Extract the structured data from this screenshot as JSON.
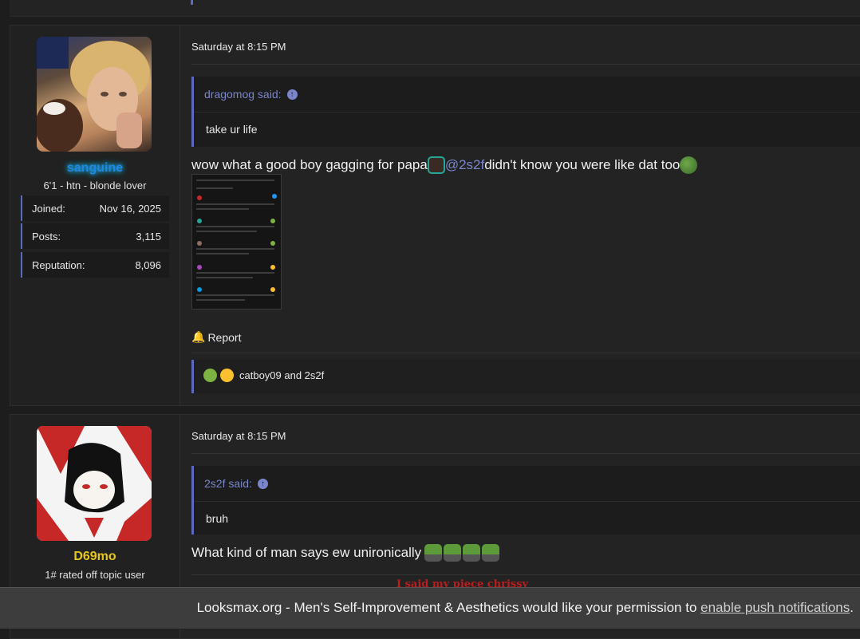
{
  "posts": [
    {
      "username": "sanguine",
      "user_title": "6'1 - htn - blonde lover",
      "stats": [
        {
          "label": "Joined:",
          "value": "Nov 16, 2025"
        },
        {
          "label": "Posts:",
          "value": "3,115"
        },
        {
          "label": "Reputation:",
          "value": "8,096"
        }
      ],
      "date": "Saturday at 8:15 PM",
      "quote": {
        "author": "dragomog said:",
        "text": "take ur life"
      },
      "message_prefix": "wow what a good boy gagging for papa ",
      "mention": "@2s2f",
      "message_suffix": " didn't know you were like dat too",
      "report_label": "Report",
      "reactions_text": "catboy09 and 2s2f"
    },
    {
      "username": "D69mo",
      "user_title": "1# rated off topic user",
      "date": "Saturday at 8:15 PM",
      "quote": {
        "author": "2s2f said:",
        "text": "bruh"
      },
      "message": "What kind of man says ew unironically",
      "signature_partial": "I said my piece chrissy"
    }
  ],
  "notification": {
    "text": "Looksmax.org - Men's Self-Improvement & Aesthetics would like your permission to ",
    "link": "enable push notifications",
    "suffix": "."
  },
  "colors": {
    "accent": "#5c6bc0",
    "username1": "#1e88e5",
    "username2": "#e6c619",
    "mention": "#7986cb"
  }
}
